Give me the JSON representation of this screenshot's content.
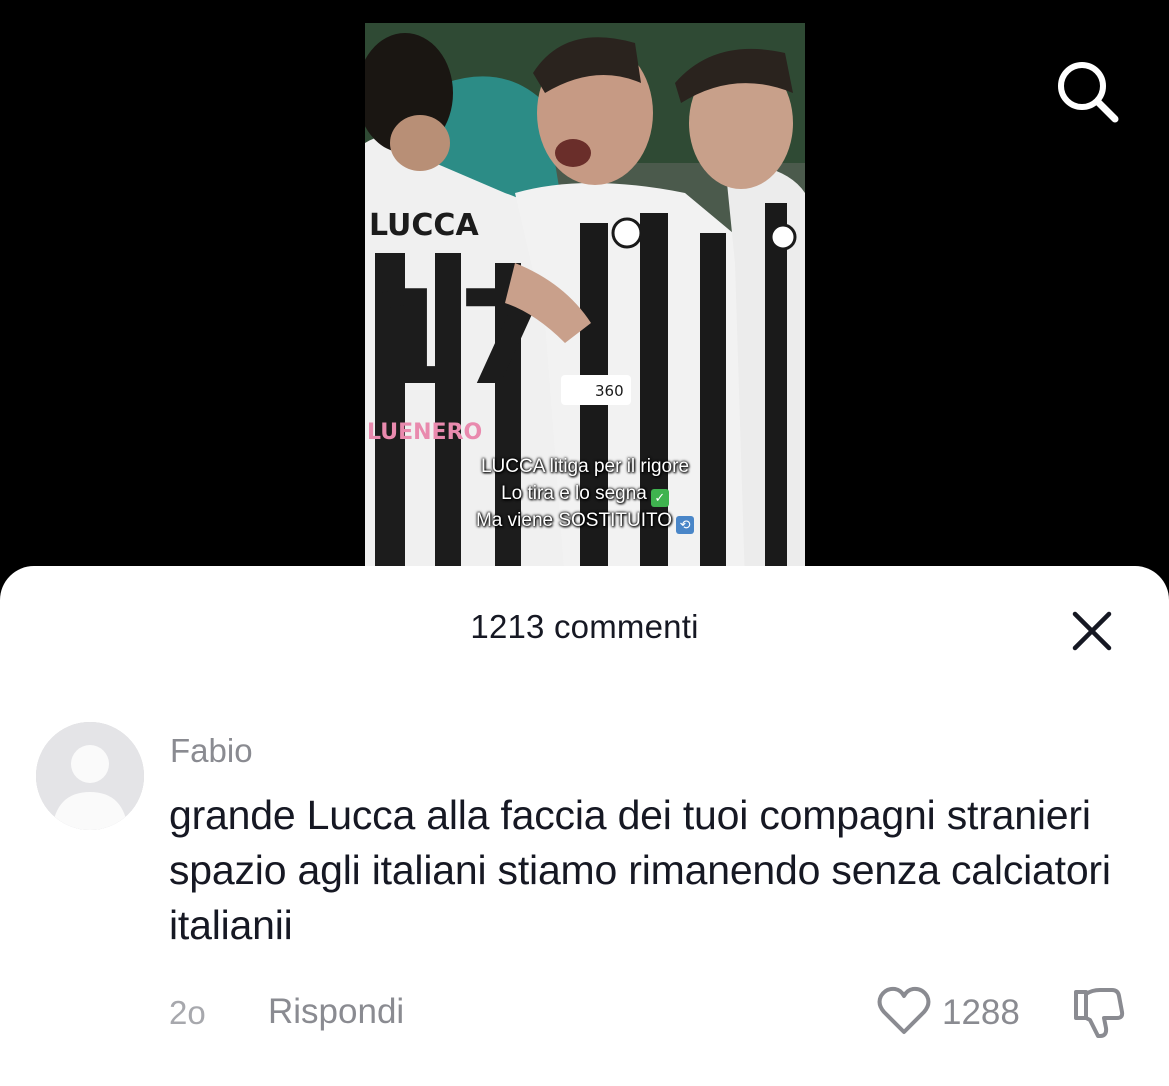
{
  "video": {
    "jersey_name": "LUCCA",
    "jersey_number": "17",
    "sleeve_text": "LUENERO",
    "sponsor_number": "360",
    "caption_lines": [
      "LUCCA litiga per il rigore",
      "Lo tira e lo segna",
      "Ma viene SOSTITUITO"
    ]
  },
  "comments_sheet": {
    "title": "1213 commenti",
    "comment": {
      "username": "Fabio",
      "text": "grande Lucca alla faccia dei tuoi compagni stranieri spazio agli italiani stiamo rimanendo senza calciatori italianii",
      "age": "2o",
      "reply_label": "Rispondi",
      "like_count": "1288"
    }
  },
  "icons": {
    "search": "search-icon",
    "close": "close-icon",
    "avatar": "default-avatar-icon",
    "like": "heart-outline-icon",
    "dislike": "thumbs-down-icon",
    "check_emoji": "check-mark-emoji",
    "arrows_emoji": "counterclockwise-arrows-emoji"
  },
  "colors": {
    "check_emoji_bg": "#3fb34f",
    "arrows_emoji_bg": "#4a86c8",
    "sheet_bg": "#ffffff",
    "muted_text": "#8a8b91"
  }
}
